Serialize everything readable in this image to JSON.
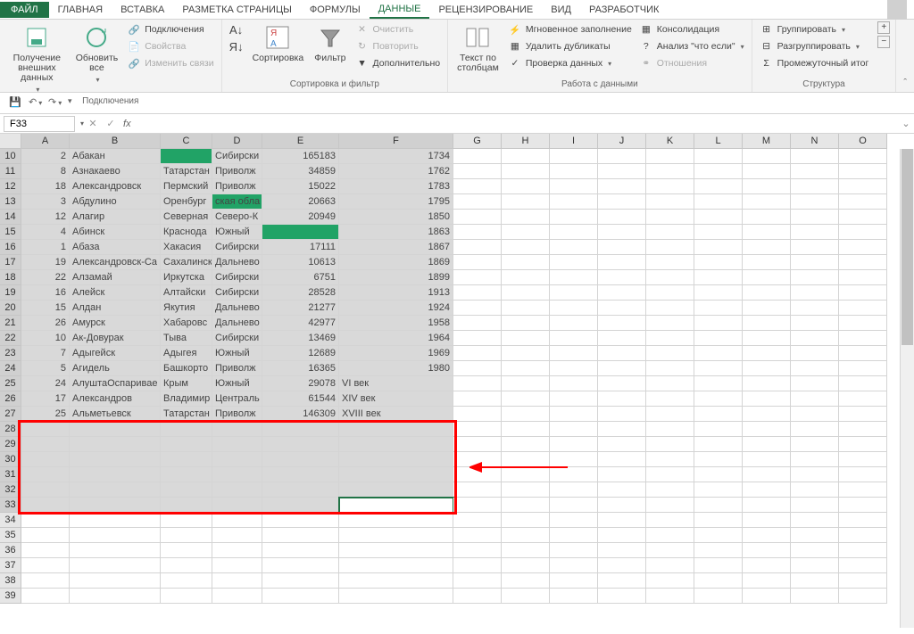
{
  "menubar": {
    "file": "ФАЙЛ",
    "tabs": [
      "ГЛАВНАЯ",
      "ВСТАВКА",
      "РАЗМЕТКА СТРАНИЦЫ",
      "ФОРМУЛЫ",
      "ДАННЫЕ",
      "РЕЦЕНЗИРОВАНИЕ",
      "ВИД",
      "РАЗРАБОТЧИК"
    ],
    "active_tab": "ДАННЫЕ"
  },
  "ribbon": {
    "groups": {
      "connections": {
        "label": "Подключения",
        "get_external": "Получение\nвнешних данных",
        "refresh_all": "Обновить\nвсе",
        "connections": "Подключения",
        "properties": "Свойства",
        "edit_links": "Изменить связи"
      },
      "sort_filter": {
        "label": "Сортировка и фильтр",
        "sort": "Сортировка",
        "filter": "Фильтр",
        "clear": "Очистить",
        "reapply": "Повторить",
        "advanced": "Дополнительно"
      },
      "data_tools": {
        "label": "Работа с данными",
        "text_to_columns": "Текст по\nстолбцам",
        "flash_fill": "Мгновенное заполнение",
        "remove_duplicates": "Удалить дубликаты",
        "data_validation": "Проверка данных",
        "consolidate": "Консолидация",
        "what_if": "Анализ \"что если\"",
        "relationships": "Отношения"
      },
      "outline": {
        "label": "Структура",
        "group": "Группировать",
        "ungroup": "Разгруппировать",
        "subtotal": "Промежуточный итог"
      }
    }
  },
  "name_box": "F33",
  "columns": [
    "A",
    "B",
    "C",
    "D",
    "E",
    "F",
    "G",
    "H",
    "I",
    "J",
    "K",
    "L",
    "M",
    "N",
    "O"
  ],
  "rows": [
    {
      "n": 10,
      "a": "2",
      "b": "Абакан",
      "c": "",
      "d": "Сибирски",
      "e": "165183",
      "f": "1734",
      "c_green": true
    },
    {
      "n": 11,
      "a": "8",
      "b": "Азнакаево",
      "c": "Татарстан",
      "d": "Приволж",
      "e": "34859",
      "f": "1762"
    },
    {
      "n": 12,
      "a": "18",
      "b": "Александровск",
      "c": "Пермский",
      "d": "Приволж",
      "e": "15022",
      "f": "1783"
    },
    {
      "n": 13,
      "a": "3",
      "b": "Абдулино",
      "c": "Оренбург",
      "d": "ская обла",
      "e": "20663",
      "f": "1795",
      "d_green": true
    },
    {
      "n": 14,
      "a": "12",
      "b": "Алагир",
      "c": "Северная",
      "d": "Северо-К",
      "e": "20949",
      "f": "1850"
    },
    {
      "n": 15,
      "a": "4",
      "b": "Абинск",
      "c": "Краснода",
      "d": "Южный",
      "e": "",
      "f": "1863",
      "e_green": true
    },
    {
      "n": 16,
      "a": "1",
      "b": "Абаза",
      "c": "Хакасия",
      "d": "Сибирски",
      "e": "17111",
      "f": "1867"
    },
    {
      "n": 17,
      "a": "19",
      "b": "Александровск-Са",
      "c": "Сахалинск",
      "d": "Дальнево",
      "e": "10613",
      "f": "1869"
    },
    {
      "n": 18,
      "a": "22",
      "b": "Алзамай",
      "c": "Иркутска",
      "d": "Сибирски",
      "e": "6751",
      "f": "1899"
    },
    {
      "n": 19,
      "a": "16",
      "b": "Алейск",
      "c": "Алтайски",
      "d": "Сибирски",
      "e": "28528",
      "f": "1913"
    },
    {
      "n": 20,
      "a": "15",
      "b": "Алдан",
      "c": "Якутия",
      "d": "Дальнево",
      "e": "21277",
      "f": "1924"
    },
    {
      "n": 21,
      "a": "26",
      "b": "Амурск",
      "c": "Хабаровс",
      "d": "Дальнево",
      "e": "42977",
      "f": "1958"
    },
    {
      "n": 22,
      "a": "10",
      "b": "Ак-Довурак",
      "c": "Тыва",
      "d": "Сибирски",
      "e": "13469",
      "f": "1964"
    },
    {
      "n": 23,
      "a": "7",
      "b": "Адыгейск",
      "c": "Адыгея",
      "d": "Южный",
      "e": "12689",
      "f": "1969"
    },
    {
      "n": 24,
      "a": "5",
      "b": "Агидель",
      "c": "Башкорто",
      "d": "Приволж",
      "e": "16365",
      "f": "1980"
    },
    {
      "n": 25,
      "a": "24",
      "b": "АлуштаОспаривае",
      "c": "Крым",
      "d": "Южный",
      "e": "29078",
      "f": "VI век",
      "f_text": true
    },
    {
      "n": 26,
      "a": "17",
      "b": "Александров",
      "c": "Владимир",
      "d": "Централь",
      "e": "61544",
      "f": "XIV век",
      "f_text": true
    },
    {
      "n": 27,
      "a": "25",
      "b": "Альметьевск",
      "c": "Татарстан",
      "d": "Приволж",
      "e": "146309",
      "f": "XVIII век",
      "f_text": true
    }
  ],
  "empty_sel_rows": [
    28,
    29,
    30,
    31,
    32,
    33
  ],
  "empty_rows": [
    34,
    35,
    36,
    37,
    38,
    39
  ],
  "active_cell_row": 33,
  "active_cell_col": "F"
}
